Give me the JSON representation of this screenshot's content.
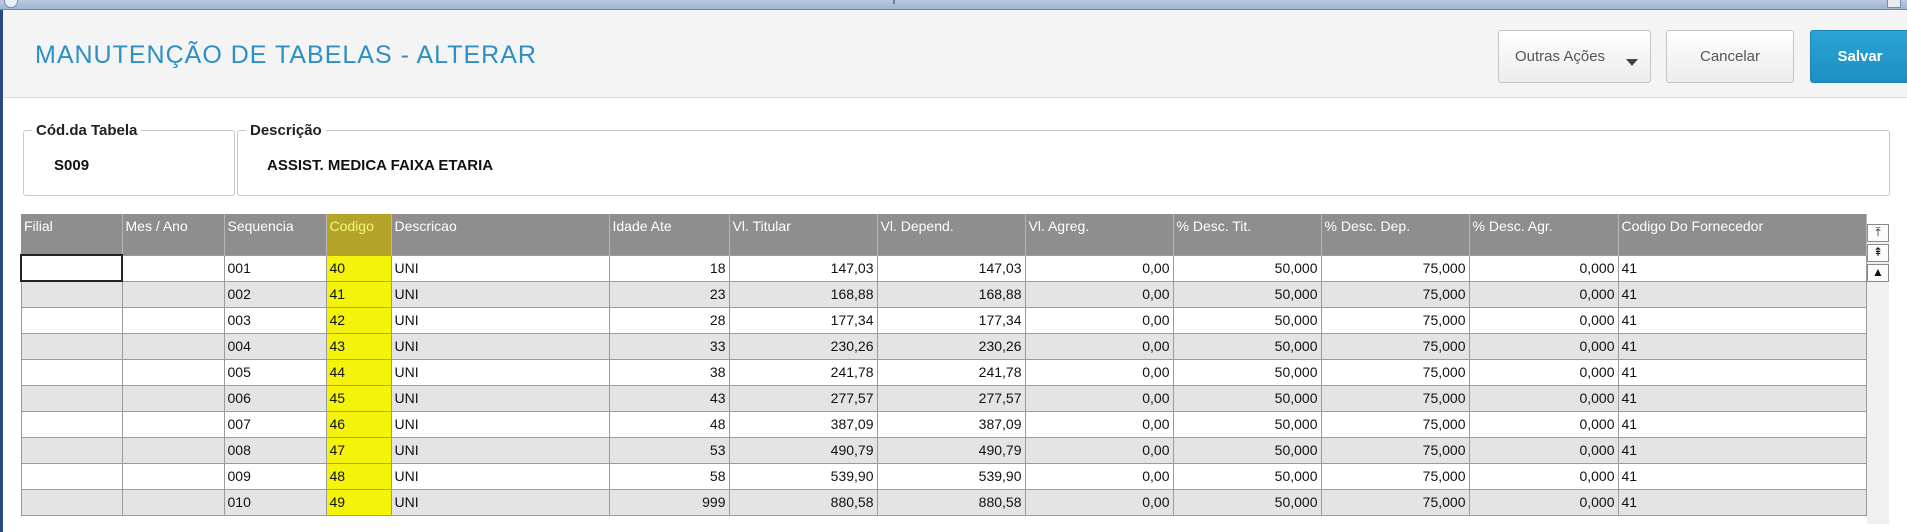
{
  "header": {
    "title": "MANUTENÇÃO DE TABELAS - ALTERAR",
    "buttons": {
      "outras_acoes": "Outras Ações",
      "cancelar": "Cancelar",
      "salvar": "Salvar"
    }
  },
  "fields": {
    "cod_tabela": {
      "label": "Cód.da Tabela",
      "value": "S009"
    },
    "descricao": {
      "label": "Descrição",
      "value": "ASSIST. MEDICA FAIXA ETARIA"
    }
  },
  "grid": {
    "columns": [
      "Filial",
      "Mes / Ano",
      "Sequencia",
      "Codigo",
      "Descricao",
      "Idade Ate",
      "Vl. Titular",
      "Vl. Depend.",
      "Vl. Agreg.",
      "% Desc. Tit.",
      "% Desc. Dep.",
      "% Desc. Agr.",
      "Codigo Do Fornecedor"
    ],
    "highlighted_column": "Codigo",
    "highlight_color": "#f4f40a",
    "rows": [
      [
        "",
        "",
        "001",
        "40",
        "UNI",
        "18",
        "147,03",
        "147,03",
        "0,00",
        "50,000",
        "75,000",
        "0,000",
        "41"
      ],
      [
        "",
        "",
        "002",
        "41",
        "UNI",
        "23",
        "168,88",
        "168,88",
        "0,00",
        "50,000",
        "75,000",
        "0,000",
        "41"
      ],
      [
        "",
        "",
        "003",
        "42",
        "UNI",
        "28",
        "177,34",
        "177,34",
        "0,00",
        "50,000",
        "75,000",
        "0,000",
        "41"
      ],
      [
        "",
        "",
        "004",
        "43",
        "UNI",
        "33",
        "230,26",
        "230,26",
        "0,00",
        "50,000",
        "75,000",
        "0,000",
        "41"
      ],
      [
        "",
        "",
        "005",
        "44",
        "UNI",
        "38",
        "241,78",
        "241,78",
        "0,00",
        "50,000",
        "75,000",
        "0,000",
        "41"
      ],
      [
        "",
        "",
        "006",
        "45",
        "UNI",
        "43",
        "277,57",
        "277,57",
        "0,00",
        "50,000",
        "75,000",
        "0,000",
        "41"
      ],
      [
        "",
        "",
        "007",
        "46",
        "UNI",
        "48",
        "387,09",
        "387,09",
        "0,00",
        "50,000",
        "75,000",
        "0,000",
        "41"
      ],
      [
        "",
        "",
        "008",
        "47",
        "UNI",
        "53",
        "490,79",
        "490,79",
        "0,00",
        "50,000",
        "75,000",
        "0,000",
        "41"
      ],
      [
        "",
        "",
        "009",
        "48",
        "UNI",
        "58",
        "539,90",
        "539,90",
        "0,00",
        "50,000",
        "75,000",
        "0,000",
        "41"
      ],
      [
        "",
        "",
        "010",
        "49",
        "UNI",
        "999",
        "880,58",
        "880,58",
        "0,00",
        "50,000",
        "75,000",
        "0,000",
        "41"
      ]
    ]
  },
  "scrollbar": {
    "icons": [
      "scroll-top-icon",
      "scroll-page-up-icon",
      "scroll-up-icon"
    ]
  },
  "colors": {
    "title": "#2e8fc4",
    "salvar_button": "#1f8fc3",
    "grid_header": "#8e8e8e",
    "row_alt": "#e4e4e4"
  }
}
